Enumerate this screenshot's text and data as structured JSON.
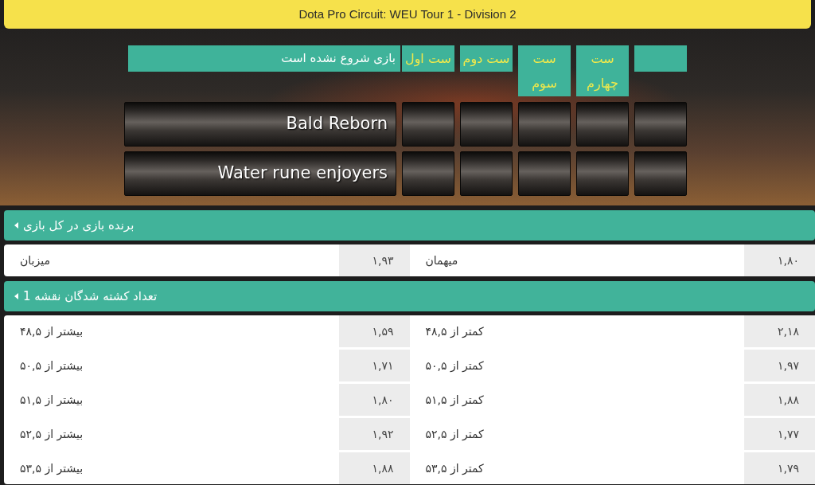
{
  "title": "Dota Pro Circuit: WEU Tour 1 - Division 2",
  "scoreboard": {
    "set_columns": [
      "ست چهارم",
      "ست سوم",
      "ست دوم",
      "ست اول"
    ],
    "status": "بازی شروع نشده است",
    "teams": [
      {
        "name": "Bald Reborn"
      },
      {
        "name": "Water rune enjoyers"
      }
    ]
  },
  "markets": [
    {
      "title": "برنده بازی در کل بازی",
      "rows": [
        {
          "outcomes": [
            {
              "odds": "۱,۸۰",
              "label": "میهمان"
            },
            {
              "odds": "۱,۹۳",
              "label": "میزبان"
            }
          ]
        }
      ]
    },
    {
      "title": "تعداد کشته شدگان نقشه 1",
      "rows": [
        {
          "outcomes": [
            {
              "odds": "۲,۱۸",
              "label": "کمتر از ۴۸,۵"
            },
            {
              "odds": "۱,۵۹",
              "label": "بیشتر از ۴۸,۵"
            }
          ]
        },
        {
          "outcomes": [
            {
              "odds": "۱,۹۷",
              "label": "کمتر از ۵۰,۵"
            },
            {
              "odds": "۱,۷۱",
              "label": "بیشتر از ۵۰,۵"
            }
          ]
        },
        {
          "outcomes": [
            {
              "odds": "۱,۸۸",
              "label": "کمتر از ۵۱,۵"
            },
            {
              "odds": "۱,۸۰",
              "label": "بیشتر از ۵۱,۵"
            }
          ]
        },
        {
          "outcomes": [
            {
              "odds": "۱,۷۷",
              "label": "کمتر از ۵۲,۵"
            },
            {
              "odds": "۱,۹۲",
              "label": "بیشتر از ۵۲,۵"
            }
          ]
        },
        {
          "outcomes": [
            {
              "odds": "۱,۷۹",
              "label": "کمتر از ۵۳,۵"
            },
            {
              "odds": "۱,۸۸",
              "label": "بیشتر از ۵۳,۵"
            }
          ]
        }
      ]
    }
  ]
}
